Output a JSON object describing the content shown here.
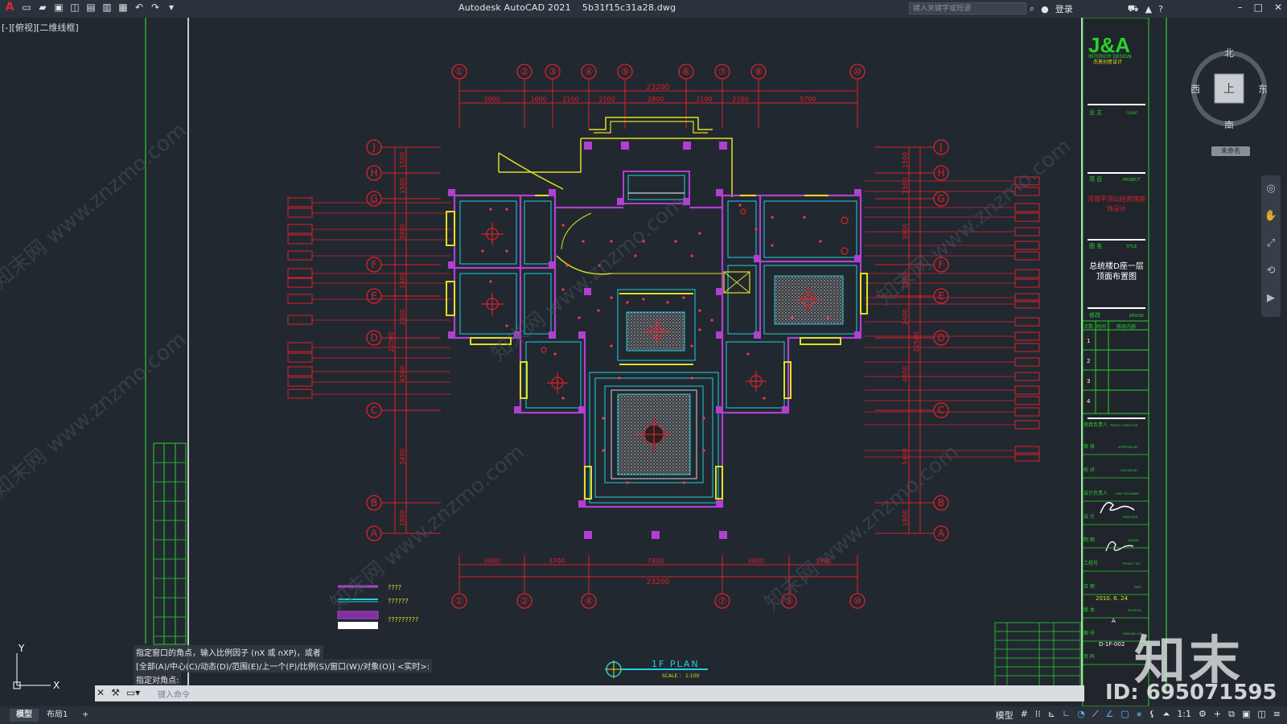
{
  "window": {
    "app_name": "Autodesk AutoCAD 2021",
    "file_name": "5b31f15c31a28.dwg",
    "search_placeholder": "键入关键字或短语",
    "login_label": "登录"
  },
  "viewport": {
    "label": "[-][俯视][二维线框]"
  },
  "drawing": {
    "top_grid_labels": [
      "①",
      "②",
      "③",
      "④",
      "⑤",
      "⑥",
      "⑦",
      "⑧",
      "⑩"
    ],
    "bottom_grid_labels": [
      "①",
      "②",
      "④",
      "⑦",
      "⑨",
      "⑩"
    ],
    "row_labels": [
      "J",
      "H",
      "G",
      "F",
      "E",
      "D",
      "C",
      "B",
      "A"
    ],
    "top_total_dim": "23200",
    "top_dims": [
      "3900",
      "1600",
      "2100",
      "2100",
      "2800",
      "2100",
      "2100",
      "5700"
    ],
    "bottom_total_dim": "23200",
    "bottom_dims": [
      "3900",
      "3700",
      "7800",
      "3900",
      "3900"
    ],
    "left_total_dim": "22500",
    "left_dims": [
      "1500",
      "1500",
      "3900",
      "1800",
      "2400",
      "4500",
      "5400",
      "1800"
    ],
    "right_total_dim": "22500",
    "right_dims": [
      "1500",
      "1500",
      "3900",
      "1800",
      "2400",
      "4000",
      "5400",
      "1800"
    ],
    "plan_title": "1F PLAN",
    "plan_scale": "SCALE ： 1:100",
    "legend_items": [
      "????",
      "??????",
      "?????????"
    ],
    "ucs_x": "X",
    "ucs_y": "Y"
  },
  "title_block": {
    "logo": "J&A",
    "logo_sub": "INTERIOR DESIGN",
    "logo_cn": "杰恩创意设计",
    "client_cn": "业  主",
    "client_en": "CLIENT",
    "project_cn": "项  目",
    "project_en": "PROJECT",
    "project_name": "河南平顶山经宾馆装饰设计",
    "title_cn": "图  名",
    "title_en": "TITLE",
    "drawing_title": "总统楼D座一层顶面布置图",
    "revise_cn": "修改",
    "revise_en": "REVISE",
    "revise_headers": [
      "次数",
      "时间",
      "修改内容"
    ],
    "revise_rows": [
      "1",
      "2",
      "3",
      "4"
    ],
    "director_cn": "项目负责人",
    "director_en": "PROJECT DIRECTOR",
    "approved_cn": "审  核",
    "approved_en": "APPROVED BY",
    "checked_cn": "校  对",
    "checked_en": "CHECKED BY",
    "designer_cn": "设计负责人",
    "designer_en": "CHIEF DESIGNER",
    "design_cn": "设  计",
    "design_en": "DESIGNER",
    "drawn_cn": "制  图",
    "drawn_en": "DRAWN",
    "project_no_cn": "工程号",
    "project_no_en": "PROJECT NO",
    "date_cn": "日  期",
    "date_en": "DATE",
    "date_value": "2010. 6. 24",
    "version_cn": "版  本",
    "version_en": "REVISION",
    "version_value": "A",
    "drawing_no_cn": "图  号",
    "drawing_no_en": "DRAWING NO",
    "drawing_no_value": "D-1F-002",
    "page_cn": "页  码"
  },
  "viewcube": {
    "north": "北",
    "south": "南",
    "east": "东",
    "west": "西",
    "face": "上",
    "wcs": "未命名"
  },
  "command_line": {
    "line1": "指定窗口的角点，输入比例因子 (nX 或 nXP)，或者",
    "line2": "[全部(A)/中心(C)/动态(D)/范围(E)/上一个(P)/比例(S)/窗口(W)/对象(O)] <实时>:",
    "line3": "指定对角点:",
    "input_placeholder": "键入命令"
  },
  "statusbar": {
    "tabs": [
      "模型",
      "布局1",
      "+"
    ],
    "model_label": "模型",
    "scale_label": "1:1"
  },
  "watermark": {
    "brand": "知末",
    "id": "ID: 695071595",
    "site": "知末网 www.znzmo.com"
  },
  "colors": {
    "background": "#212830",
    "grid_red": "#e0202a",
    "wall_magenta": "#b040d0",
    "window_yellow": "#e0e020",
    "cyan": "#20d0e0",
    "green": "#20c020",
    "white": "#ffffff"
  }
}
